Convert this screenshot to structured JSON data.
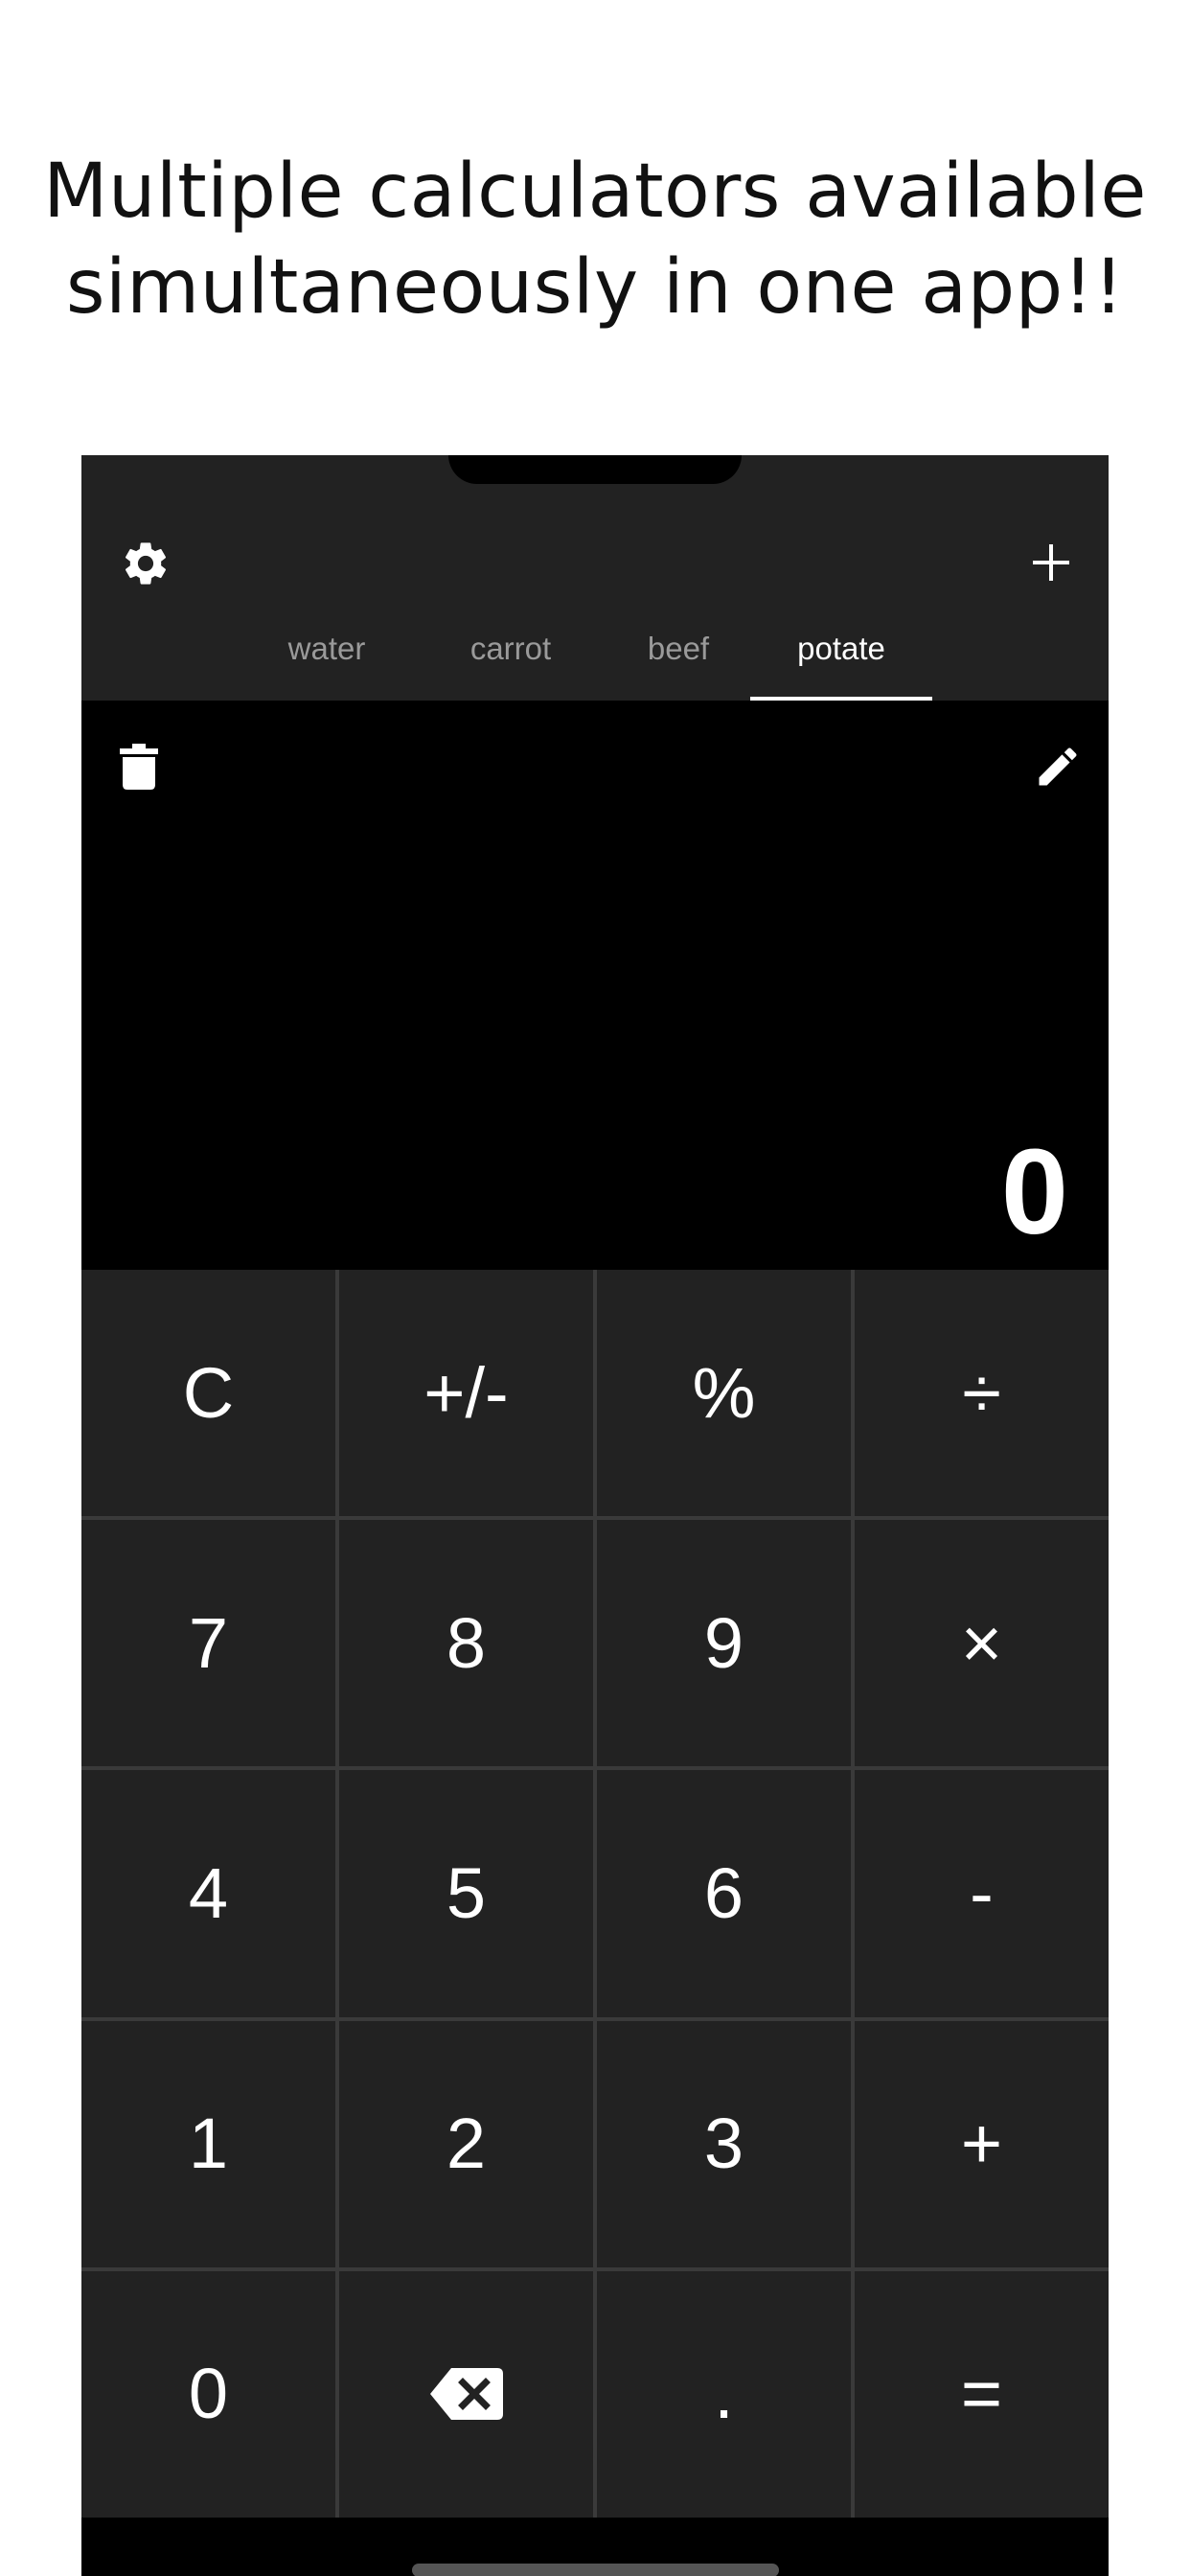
{
  "headline": {
    "line1": "Multiple calculators available",
    "line2": "simultaneously in one app!!"
  },
  "appbar": {
    "settings_icon": "gear-icon",
    "add_icon": "plus-icon",
    "tabs": [
      {
        "label": "water",
        "active": false
      },
      {
        "label": "carrot",
        "active": false
      },
      {
        "label": "beef",
        "active": false
      },
      {
        "label": "potate",
        "active": true
      }
    ]
  },
  "display": {
    "delete_icon": "trash-icon",
    "edit_icon": "pencil-icon",
    "value": "0"
  },
  "keypad": {
    "rows": [
      [
        "C",
        "+/-",
        "%",
        "÷"
      ],
      [
        "7",
        "8",
        "9",
        "×"
      ],
      [
        "4",
        "5",
        "6",
        "-"
      ],
      [
        "1",
        "2",
        "3",
        "+"
      ],
      [
        "0",
        "backspace-icon",
        ".",
        "="
      ]
    ]
  },
  "colors": {
    "appbar_bg": "#222222",
    "display_bg": "#000000",
    "key_bg": "#222222",
    "key_border": "#3a3a3a",
    "text_primary": "#ffffff",
    "tab_inactive": "#9a9a9a"
  }
}
